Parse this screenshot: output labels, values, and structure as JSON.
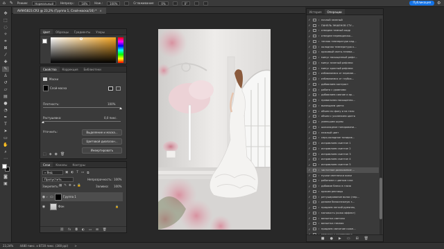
{
  "options_bar": {
    "mode_label": "Режим:",
    "mode_value": "Нормальный",
    "opacity_label": "Непрозр.:",
    "opacity_value": "18%",
    "flow_label": "Наж.:",
    "flow_value": "100%",
    "smoothing_label": "Сглаживание:",
    "smoothing_value": "0%",
    "angle_value": "0°",
    "publish_label": "Публикация"
  },
  "document": {
    "tab_title": "AV9A5823.CR3 @ 23,2% (Группа 1, Слой-маска/16) *",
    "close_glyph": "×"
  },
  "status_bar": {
    "zoom": "23,24%",
    "dimensions": "4480 пикс. x 8720 пикс. (300 ppi)",
    "arrow": ">"
  },
  "color_panel": {
    "tabs": [
      "Цвет",
      "Образцы",
      "Градиенты",
      "Узоры"
    ],
    "accent_color": "#f5a623"
  },
  "properties_panel": {
    "tabs": [
      "Свойства",
      "Коррекция",
      "Библиотеки"
    ],
    "mask_heading": "Маски",
    "layer_mask_label": "Слой-маска",
    "density_label": "Плотность:",
    "density_value": "100%",
    "feather_label": "Растушевка:",
    "feather_value": "0,0 пикс.",
    "refine_label": "Уточнить:",
    "select_mask_button": "Выделение и маска...",
    "color_range_button": "Цветовой диапазон...",
    "invert_button": "Инвертировать"
  },
  "layers_panel": {
    "tabs": [
      "Слои",
      "Каналы",
      "Контуры"
    ],
    "search_value": "Вид",
    "blend_mode": "Пропустить",
    "opacity_label": "Непрозрачность:",
    "opacity_value": "100%",
    "lock_label": "Закрепить:",
    "fill_label": "Заливка:",
    "fill_value": "100%",
    "layers": [
      {
        "name": "Группа 1",
        "selected": true
      },
      {
        "name": "Фон",
        "selected": false
      }
    ],
    "footer_icons": [
      "link-icon",
      "fx-icon",
      "mask-icon",
      "adjustment-icon",
      "folder-icon",
      "new-layer-icon",
      "trash-icon"
    ]
  },
  "history_panel": {
    "tabs": [
      "История",
      "Операции"
    ],
    "items": [
      {
        "label": "ночной зеленый",
        "checked": true,
        "selected": false
      },
      {
        "label": "ПАНЕЛЬ ЭКШЕНОВ СТУ...",
        "checked": true,
        "selected": false
      },
      {
        "label": "отведем темный кадр",
        "checked": true,
        "selected": false
      },
      {
        "label": "отведем переводнико...",
        "checked": true,
        "selected": false
      },
      {
        "label": "теплая температура кад...",
        "checked": true,
        "selected": false
      },
      {
        "label": "холодная температура к...",
        "checked": true,
        "selected": false
      },
      {
        "label": "красивый свето-тенева...",
        "checked": true,
        "selected": false
      },
      {
        "label": "минус насыщенный рефл...",
        "checked": true,
        "selected": false
      },
      {
        "label": "минус зеленый рефлекс",
        "checked": true,
        "selected": false
      },
      {
        "label": "минус красный рефлекс",
        "checked": true,
        "selected": false
      },
      {
        "label": "избавляемся от пересве...",
        "checked": true,
        "selected": false
      },
      {
        "label": "избавляемся от глубок...",
        "checked": true,
        "selected": false
      },
      {
        "label": "добавляем контраст",
        "checked": true,
        "selected": false
      },
      {
        "label": "работа с уровнями",
        "checked": true,
        "selected": false
      },
      {
        "label": "добавляем сияние и яр...",
        "checked": true,
        "selected": false
      },
      {
        "label": "правильная насыщенно...",
        "checked": true,
        "selected": false
      },
      {
        "label": "вымещаем цвета",
        "checked": true,
        "selected": false
      },
      {
        "label": "объем по фону и на тело",
        "checked": true,
        "selected": false
      },
      {
        "label": "объем с усилением цвета",
        "checked": true,
        "selected": false
      },
      {
        "label": "уменьшим шумы",
        "checked": true,
        "selected": false
      },
      {
        "label": "шоколадное тонировани...",
        "checked": true,
        "selected": false
      },
      {
        "label": "нежный цвет",
        "checked": true,
        "selected": false
      },
      {
        "label": "серо-холодное тониров...",
        "checked": true,
        "selected": false
      },
      {
        "label": "исправляем скинтон 1",
        "checked": true,
        "selected": false
      },
      {
        "label": "исправляем скинтон 2",
        "checked": true,
        "selected": false
      },
      {
        "label": "исправляем скинтон 3",
        "checked": true,
        "selected": false
      },
      {
        "label": "исправляем скинтон 4",
        "checked": true,
        "selected": false
      },
      {
        "label": "исправляем скинтон 5",
        "checked": true,
        "selected": false
      },
      {
        "label": "частотное разложение ...",
        "checked": true,
        "selected": true
      },
      {
        "label": "пушки светлячки кожи",
        "checked": true,
        "selected": false
      },
      {
        "label": "работаем с цветом глаз",
        "checked": true,
        "selected": false
      },
      {
        "label": "добавим блеск в глаза",
        "checked": true,
        "selected": false
      },
      {
        "label": "красим ресницы",
        "checked": true,
        "selected": false
      },
      {
        "label": "ретуширование волос (пер...",
        "checked": true,
        "selected": false
      },
      {
        "label": "делаем белоснежную з...",
        "checked": true,
        "selected": false
      },
      {
        "label": "придаем легкий румянец",
        "checked": true,
        "selected": false
      },
      {
        "label": "матовость (кожа эффект)",
        "checked": true,
        "selected": false
      },
      {
        "label": "виньетка светлая",
        "checked": true,
        "selected": false
      },
      {
        "label": "виньетка темная",
        "checked": true,
        "selected": false
      },
      {
        "label": "придаем свечение коже...",
        "checked": true,
        "selected": false
      },
      {
        "label": "резкость с усилением к...",
        "checked": true,
        "selected": false
      },
      {
        "label": "резкость и четкость",
        "checked": true,
        "selected": false
      },
      {
        "label": "сохранение веб версии",
        "checked": true,
        "selected": false
      }
    ]
  }
}
